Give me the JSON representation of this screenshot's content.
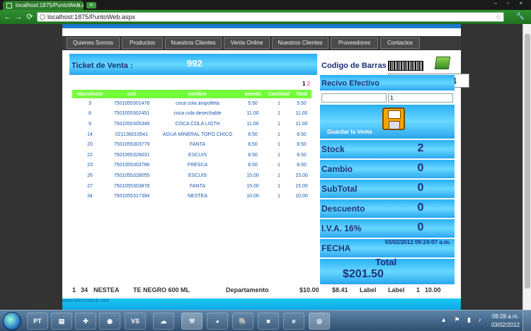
{
  "browser": {
    "tab_title": "localhost:1875/PuntoWeb.a",
    "tab_close": "x",
    "new_tab": "+",
    "window_controls": "– ▫ ×",
    "back": "←",
    "forward": "→",
    "reload": "⟳",
    "url": "localhost:1875/PuntoWeb.aspx",
    "star": "☆",
    "wrench": "🔧"
  },
  "menu": [
    {
      "label": "Quienes Somos"
    },
    {
      "label": "Productos"
    },
    {
      "label": "Nuestros Clientes"
    },
    {
      "label": "Venta Online"
    },
    {
      "label": "Nuestros Clientes"
    },
    {
      "label": "Proveedores"
    },
    {
      "label": "Contactos"
    }
  ],
  "ticket": {
    "label": "Ticket de Venta  :",
    "number": "992",
    "pager_current": "1",
    "pager_next": "2"
  },
  "barcode": {
    "label": "Codigo de Barras",
    "value": "7501055317394"
  },
  "recibo": {
    "label": "Recivo Efectivo",
    "amount": "",
    "quantity": "1"
  },
  "save_label": "Guardar la Venta",
  "grid": {
    "headers": [
      "idproducto",
      "cod",
      "nombre",
      "pventa",
      "Cantidad",
      "Total"
    ],
    "rows": [
      [
        "3",
        "7501055301478",
        "coca cola ampolleta",
        "5.50",
        "1",
        "5.50"
      ],
      [
        "8",
        "7501055302451",
        "coca cola desechable",
        "11.00",
        "1",
        "11.00"
      ],
      [
        "9",
        "7501055305346",
        "COCA COLA LIGTH",
        "11.00",
        "1",
        "11.00"
      ],
      [
        "14",
        "021136010541",
        "AGUA MINERAL TOPO CHICO",
        "8.50",
        "1",
        "8.50"
      ],
      [
        "20",
        "7501055303779",
        "FANTA",
        "8.50",
        "1",
        "8.50"
      ],
      [
        "22",
        "7501055328031",
        "ESCUIS",
        "8.50",
        "1",
        "8.50"
      ],
      [
        "23",
        "7501055303786",
        "FRESCA",
        "8.50",
        "1",
        "8.50"
      ],
      [
        "26",
        "7501055328055",
        "ESCUIS",
        "15.00",
        "1",
        "15.00"
      ],
      [
        "27",
        "7501055303878",
        "FANTA",
        "15.00",
        "1",
        "15.00"
      ],
      [
        "34",
        "7501055317394",
        "NESTEA",
        "10.00",
        "1",
        "10.00"
      ]
    ]
  },
  "stats": {
    "stock": {
      "label": "Stock",
      "value": "2"
    },
    "cambio": {
      "label": "Cambio",
      "value": "0"
    },
    "subtotal": {
      "label": "SubTotal",
      "value": "0"
    },
    "descuento": {
      "label": "Descuento",
      "value": "0"
    },
    "iva": {
      "label": "I.V.A. 16%",
      "value": "0"
    },
    "fecha": {
      "label": "FECHA",
      "value": "03/02/2012 09:24:07 a.m."
    },
    "total": {
      "label": "Total",
      "value": "$201.50"
    }
  },
  "footer_line": {
    "qty": "1",
    "id": "34",
    "name": "NESTEA",
    "desc": "TE NEGRO 600 ML",
    "dept": "Departamento",
    "price1": "$10.00",
    "price2": "$8.41",
    "label1": "Label",
    "label2": "Label",
    "qty2": "1",
    "total": "10.00"
  },
  "site_footer": "www.MicroStock.com",
  "taskbar": {
    "apps": [
      "PT",
      "▤",
      "✚",
      "◉",
      "VS",
      "☁",
      "⚒",
      "◕",
      "🐘",
      "■",
      "e",
      "◎"
    ],
    "tray_icons": "▲ ⚑ ▮ ♪",
    "time": "09:28 a.m.",
    "date": "03/02/2012"
  }
}
